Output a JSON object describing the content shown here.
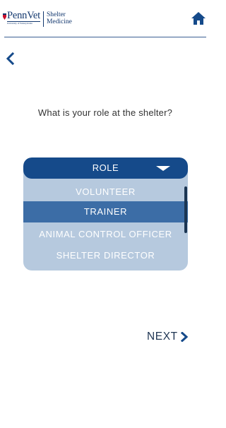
{
  "header": {
    "logo_brand": "PennVet",
    "logo_subtitle": "University of Pennsylvania",
    "logo_dept_line1": "Shelter",
    "logo_dept_line2": "Medicine",
    "home_icon": "home-icon"
  },
  "nav": {
    "back_icon": "chevron-left-icon"
  },
  "question": {
    "text": "What is your role at the shelter?"
  },
  "role_select": {
    "label": "ROLE",
    "caret_icon": "caret-down-icon",
    "options": [
      {
        "label": "VOLUNTEER",
        "selected": false
      },
      {
        "label": "TRAINER",
        "selected": true
      },
      {
        "label": "ANIMAL CONTROL OFFICER",
        "selected": false
      },
      {
        "label": "SHELTER DIRECTOR",
        "selected": false
      }
    ]
  },
  "footer": {
    "next_label": "NEXT",
    "next_icon": "chevron-right-icon"
  },
  "colors": {
    "brand_navy": "#154a8a",
    "dropdown_bg": "#b6c9de",
    "selected_bg": "#3c6da6",
    "text_dark": "#333333"
  }
}
